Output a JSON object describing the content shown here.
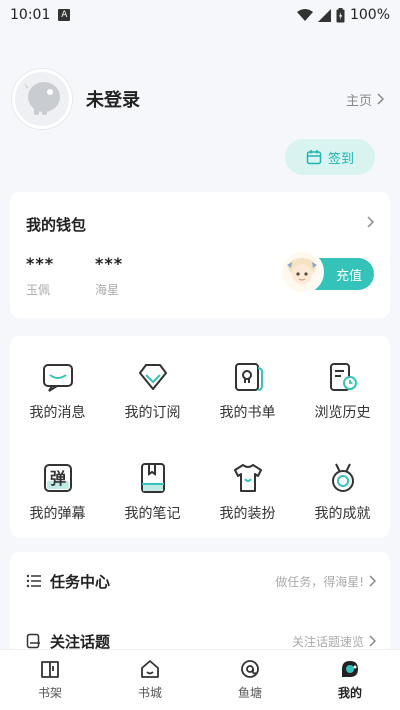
{
  "status_bar": {
    "time": "10:01",
    "badge": "A",
    "battery": "100%"
  },
  "profile": {
    "name": "未登录",
    "homepage": "主页"
  },
  "checkin": {
    "label": "签到"
  },
  "wallet": {
    "title": "我的钱包",
    "items": [
      {
        "value": "***",
        "label": "玉佩"
      },
      {
        "value": "***",
        "label": "海星"
      }
    ],
    "recharge_label": "充值"
  },
  "grid": {
    "items": [
      {
        "label": "我的消息",
        "icon": "message-icon"
      },
      {
        "label": "我的订阅",
        "icon": "diamond-icon"
      },
      {
        "label": "我的书单",
        "icon": "booklist-icon"
      },
      {
        "label": "浏览历史",
        "icon": "history-icon"
      },
      {
        "label": "我的弹幕",
        "icon": "danmaku-icon"
      },
      {
        "label": "我的笔记",
        "icon": "notes-icon"
      },
      {
        "label": "我的装扮",
        "icon": "outfit-icon"
      },
      {
        "label": "我的成就",
        "icon": "medal-icon"
      }
    ],
    "danmaku_glyph": "弹"
  },
  "list": {
    "task": {
      "title": "任务中心",
      "subtitle": "做任务，得海星!"
    },
    "topics": {
      "title": "关注话题",
      "subtitle": "关注话题速览"
    }
  },
  "tabbar": {
    "tabs": [
      {
        "label": "书架",
        "icon": "bookshelf-icon"
      },
      {
        "label": "书城",
        "icon": "bookstore-icon"
      },
      {
        "label": "鱼塘",
        "icon": "fishpond-icon"
      },
      {
        "label": "我的",
        "icon": "mine-icon",
        "active": true
      }
    ]
  },
  "colors": {
    "accent": "#33c3b8",
    "accent_light": "#d9f3f1",
    "background": "#f5f7fa"
  }
}
